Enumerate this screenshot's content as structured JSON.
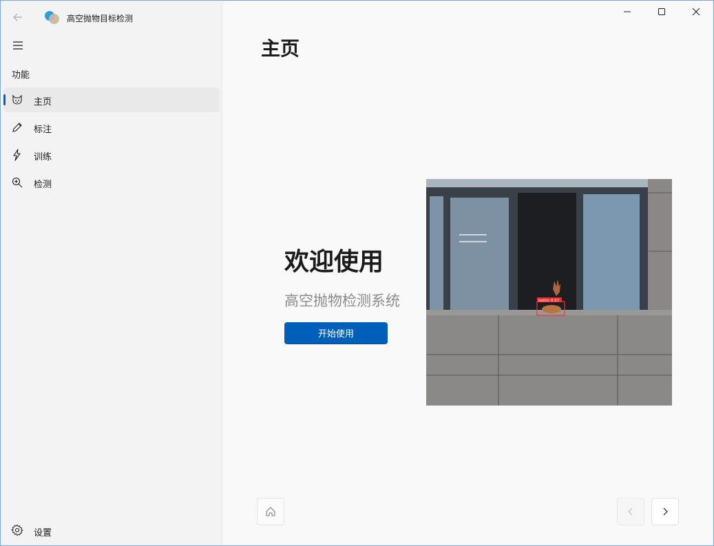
{
  "app": {
    "title": "高空抛物目标检测"
  },
  "sidebar": {
    "section_label": "功能",
    "items": [
      {
        "label": "主页",
        "icon": "cat-icon",
        "active": true
      },
      {
        "label": "标注",
        "icon": "pencil-icon",
        "active": false
      },
      {
        "label": "训练",
        "icon": "lightning-icon",
        "active": false
      },
      {
        "label": "检测",
        "icon": "zoom-in-icon",
        "active": false
      }
    ],
    "settings_label": "设置"
  },
  "main": {
    "page_title": "主页",
    "welcome": "欢迎使用",
    "subtitle": "高空抛物检测系统",
    "start_button": "开始使用",
    "photo": {
      "detection_label": "bottle 0.57"
    }
  },
  "colors": {
    "accent": "#005fb8",
    "sidebar_bg": "#f3f3f3",
    "main_bg": "#f9f9f9"
  }
}
